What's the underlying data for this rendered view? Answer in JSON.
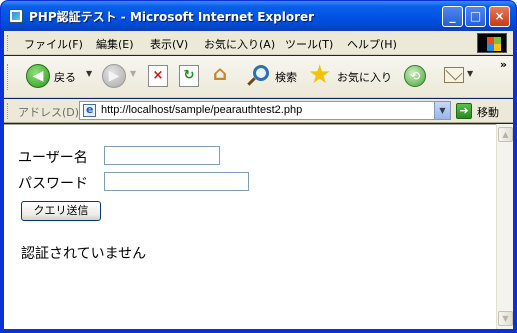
{
  "window": {
    "title": "PHP認証テスト - Microsoft Internet Explorer",
    "min_glyph": "_",
    "max_glyph": "□",
    "close_glyph": "×"
  },
  "menu": {
    "items": [
      {
        "label": "ファイル(F)"
      },
      {
        "label": "編集(E)"
      },
      {
        "label": "表示(V)"
      },
      {
        "label": "お気に入り(A)"
      },
      {
        "label": "ツール(T)"
      },
      {
        "label": "ヘルプ(H)"
      }
    ]
  },
  "toolbar": {
    "back_label": "戻る",
    "search_label": "検索",
    "favorites_label": "お気に入り",
    "icons": [
      "back-arrow",
      "forward-arrow",
      "stop",
      "refresh",
      "home",
      "search",
      "favorites-star",
      "history",
      "mail"
    ]
  },
  "address": {
    "label": "アドレス(D)",
    "url": "http://localhost/sample/pearauthtest2.php",
    "go_label": "移動"
  },
  "form": {
    "username_label": "ユーザー名",
    "password_label": "パスワード",
    "username_value": "",
    "password_value": "",
    "submit_label": "クエリ送信"
  },
  "status": {
    "message": "認証されていません"
  },
  "colors": {
    "titlebar": "#0055e5",
    "chrome": "#ece9d8",
    "frame": "#0831d9",
    "close_button": "#c43b13"
  }
}
